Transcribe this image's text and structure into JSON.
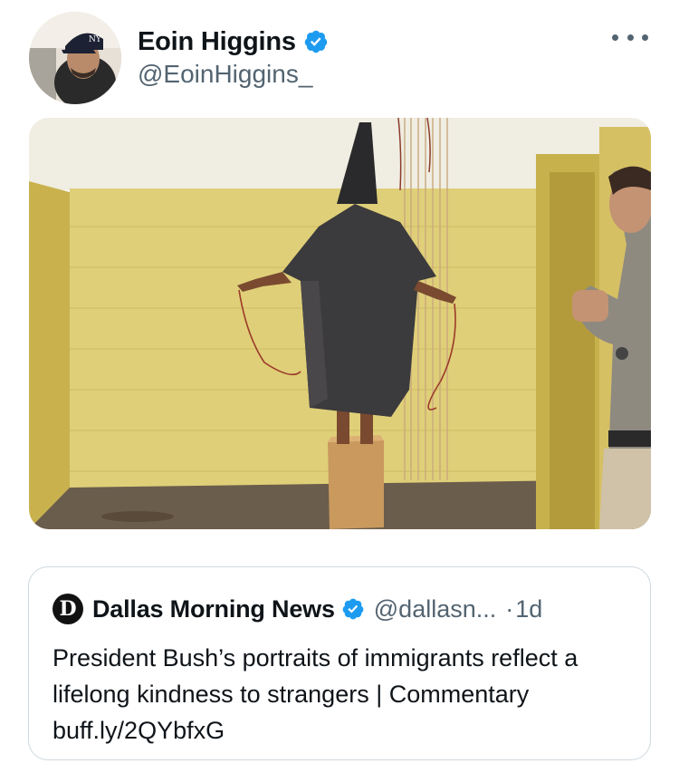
{
  "tweet": {
    "author_name": "Eoin Higgins",
    "author_handle": "@EoinHiggins_",
    "verified": true,
    "more_icon": "more-horizontal-icon"
  },
  "quoted_tweet": {
    "logo_letter": "D",
    "author_name": "Dallas Morning News",
    "verified": true,
    "author_handle": "@dallasn...",
    "separator": "·",
    "time": "1d",
    "text": "President Bush’s portraits of immigrants reflect a lifelong kindness to strangers | Commentary buff.ly/2QYbfxG"
  },
  "colors": {
    "verified_blue": "#1d9bf0",
    "text": "#0f1419",
    "secondary_text": "#536471",
    "border": "#cfd9de"
  }
}
